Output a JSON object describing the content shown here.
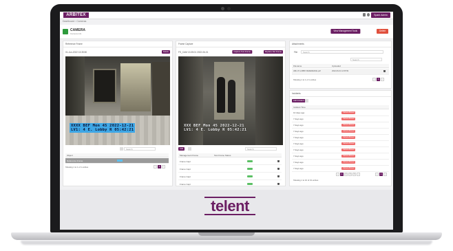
{
  "app": {
    "logo": "ARBITEX",
    "top_button": "Spark Admin",
    "breadcrumb": "Dashboard › Cameras"
  },
  "page": {
    "title": "CAMERA",
    "subtitle": "Camera info",
    "actions": {
      "secondary": "View Management Tools",
      "danger": "Delete"
    }
  },
  "panels": {
    "left": {
      "title": "Reference Frame",
      "timestamp": "01-Jun-2022 13:35:50",
      "button": "Delete",
      "osd_line1": "XXXX BEF Mon 45 2022-12-21",
      "osd_line2": "LV1: 4 E. Lobby R 05:42:21",
      "search_placeholder": "Search",
      "table_header": "Object",
      "row_label": "Reference Frame",
      "footer": "Showing 1 to 1 of 1 entries"
    },
    "middle": {
      "title": "Frame Capture",
      "timestamp": "FS_CAM 13:35:01 2022-06-01",
      "button_a": "Capture Test Frame",
      "button_b": "Replace Ref Frame",
      "osd_line1": "XXX BEF Mon 45 2022-12-21",
      "osd_line2": "LV1: 4 E. Lobby R 05:42:21",
      "add_button": "Add",
      "search_placeholder": "Search",
      "col1": "Management Frame",
      "col2": "Test Frame Status",
      "rows": [
        "Frame Capt",
        "Frame Capt",
        "Frame Capt",
        "Frame Capt"
      ]
    },
    "right_top": {
      "title": "Attachments",
      "search_label": "File",
      "search_placeholder": "Search",
      "col1": "Filename",
      "col2": "Uploaded",
      "row_file": "ABC-07-LOBBY-REFERENCE.pdf",
      "row_date": "2022-06-01 12:05:59",
      "footer": "Showing 1 to 1 of 1 entries"
    },
    "right_bottom": {
      "title": "Incidents",
      "button": "Add Incident",
      "col1": "Incident Time",
      "rows": [
        {
          "label": "10 days ago",
          "status": "Camera Moved"
        },
        {
          "label": "7 days ago",
          "status": "Camera Moved"
        },
        {
          "label": "7 days ago",
          "status": "Camera Moved"
        },
        {
          "label": "7 days ago",
          "status": "Camera Moved"
        },
        {
          "label": "7 days ago",
          "status": "Camera Moved"
        },
        {
          "label": "7 days ago",
          "status": "Camera Moved"
        },
        {
          "label": "7 days ago",
          "status": "Camera Moved"
        },
        {
          "label": "7 days ago",
          "status": "Camera Moved"
        },
        {
          "label": "7 days ago",
          "status": "Camera Moved"
        },
        {
          "label": "7 days ago",
          "status": "Camera Moved"
        }
      ],
      "footer": "Showing 1 to 10 of 31 entries"
    }
  },
  "pagination": [
    "‹",
    "1",
    "›"
  ],
  "pagination_long": [
    "‹",
    "1",
    "2",
    "3",
    "4",
    "›"
  ],
  "brand": {
    "name": "telent",
    "tagline": ""
  },
  "colors": {
    "accent": "#6b1e63",
    "danger": "#e0503d",
    "success": "#5bc064"
  },
  "icons": [
    "camera-icon",
    "bell-icon",
    "user-icon",
    "download-icon"
  ]
}
